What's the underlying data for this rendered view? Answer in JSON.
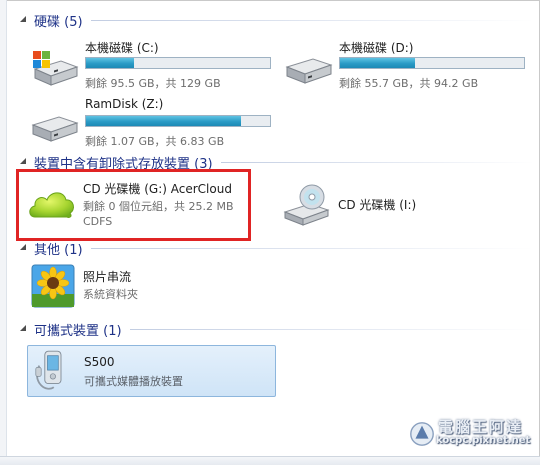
{
  "groups": {
    "hard_disks": {
      "title": "硬碟 (5)"
    },
    "removable": {
      "title": "裝置中含有卸除式存放裝置 (3)"
    },
    "other": {
      "title": "其他 (1)"
    },
    "portable": {
      "title": "可攜式裝置 (1)"
    }
  },
  "drives": [
    {
      "name": "本機磁碟 (C:)",
      "size_text": "剩餘 95.5 GB，共 129 GB",
      "used_fraction": 0.26,
      "icon": "windows-drive-icon"
    },
    {
      "name": "本機磁碟 (D:)",
      "size_text": "剩餘 55.7 GB，共 94.2 GB",
      "used_fraction": 0.41,
      "icon": "hard-drive-icon"
    },
    {
      "name": "RamDisk (Z:)",
      "size_text": "剩餘 1.07 GB，共 6.83 GB",
      "used_fraction": 0.84,
      "icon": "hard-drive-icon"
    }
  ],
  "removable_items": [
    {
      "name": "CD 光碟機 (G:) AcerCloud",
      "size_text": "剩餘 0 個位元組，共 25.2 MB",
      "fs": "CDFS",
      "icon": "cloud-icon"
    },
    {
      "name": "CD 光碟機 (I:)",
      "icon": "cd-drive-icon"
    }
  ],
  "other_items": [
    {
      "name": "照片串流",
      "desc": "系統資料夾",
      "icon": "sunflower-photo-icon"
    }
  ],
  "portable_items": [
    {
      "name": "S500",
      "desc": "可攜式媒體播放裝置",
      "icon": "phone-icon"
    }
  ],
  "watermark": {
    "title": "電腦王阿達",
    "url": "kocpc.pixnet.net"
  },
  "colors": {
    "group_title": "#1e3287",
    "bar_fill": "#2a9bc6",
    "highlight": "#e02424",
    "selection": "#cfe4f7"
  }
}
